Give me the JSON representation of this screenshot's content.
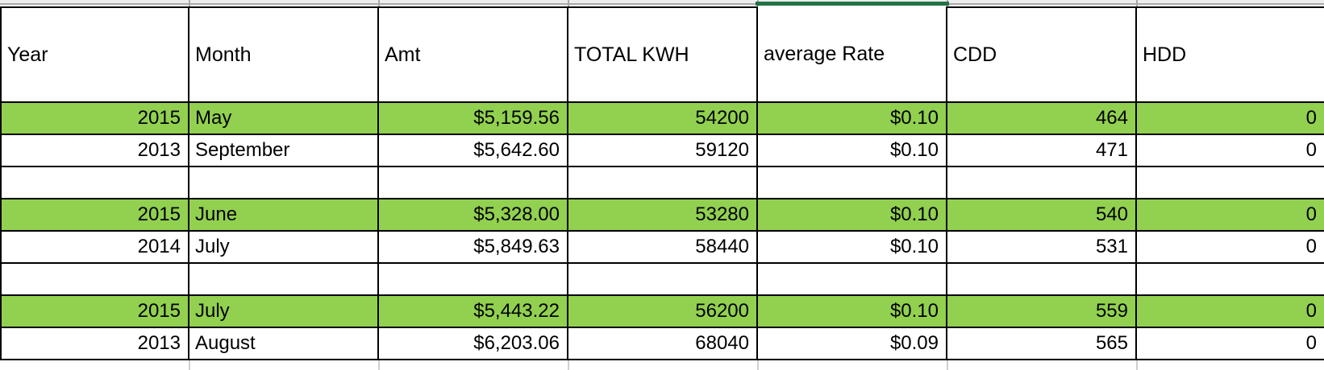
{
  "table": {
    "headers": [
      "Year",
      "Month",
      "Amt",
      "TOTAL KWH",
      "average Rate",
      "CDD",
      "HDD"
    ],
    "rows": [
      {
        "year": "2015",
        "month": "May",
        "amt": "$5,159.56",
        "kwh": "54200",
        "rate": "$0.10",
        "cdd": "464",
        "hdd": "0"
      },
      {
        "year": "2013",
        "month": "September",
        "amt": "$5,642.60",
        "kwh": "59120",
        "rate": "$0.10",
        "cdd": "471",
        "hdd": "0"
      },
      {
        "year": "",
        "month": "",
        "amt": "",
        "kwh": "",
        "rate": "",
        "cdd": "",
        "hdd": ""
      },
      {
        "year": "2015",
        "month": "June",
        "amt": "$5,328.00",
        "kwh": "53280",
        "rate": "$0.10",
        "cdd": "540",
        "hdd": "0"
      },
      {
        "year": "2014",
        "month": "July",
        "amt": "$5,849.63",
        "kwh": "58440",
        "rate": "$0.10",
        "cdd": "531",
        "hdd": "0"
      },
      {
        "year": "",
        "month": "",
        "amt": "",
        "kwh": "",
        "rate": "",
        "cdd": "",
        "hdd": ""
      },
      {
        "year": "2015",
        "month": "July",
        "amt": "$5,443.22",
        "kwh": "56200",
        "rate": "$0.10",
        "cdd": "559",
        "hdd": "0"
      },
      {
        "year": "2013",
        "month": "August",
        "amt": "$6,203.06",
        "kwh": "68040",
        "rate": "$0.09",
        "cdd": "565",
        "hdd": "0"
      }
    ]
  },
  "colors": {
    "highlight": "#92D050",
    "selection_border": "#217346",
    "gridline_gray": "#a8a8a8",
    "gridline_light": "#cfcfcf",
    "band_gray": "#ededed"
  }
}
